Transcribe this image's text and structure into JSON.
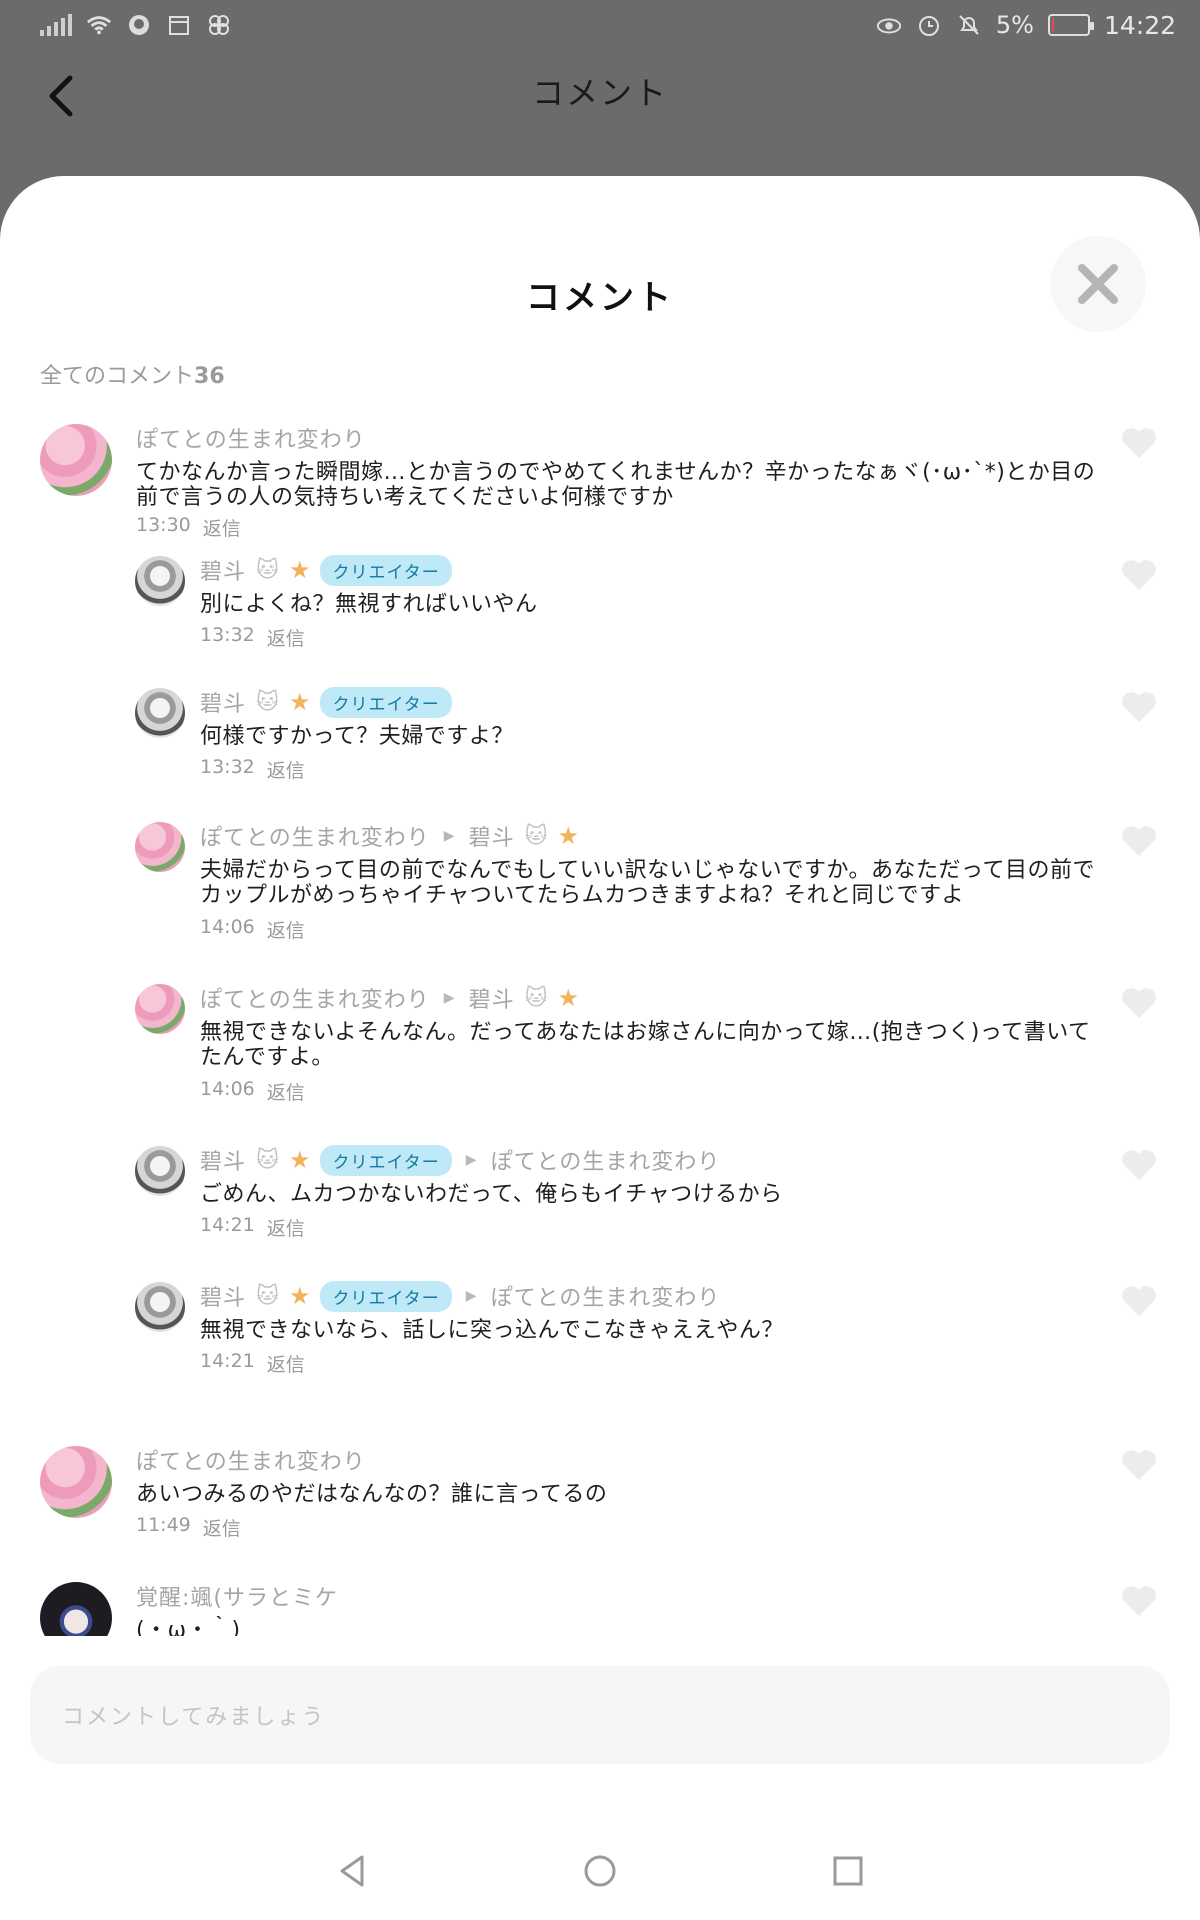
{
  "status_bar": {
    "battery_percent": "5%",
    "battery_level": 0.05,
    "time": "14:22",
    "battery_color": "#e64a4a"
  },
  "header": {
    "title": "コメント"
  },
  "sheet": {
    "title": "コメント",
    "count_label": "全てのコメント",
    "count_value": "36",
    "reply_label": "返信",
    "input_placeholder": "コメントしてみましょう"
  },
  "comments": [
    {
      "name": "ぽてとの生まれ変わり",
      "text": "てかなんか言った瞬間嫁…とか言うのでやめてくれませんか？辛かったなぁヾ(･ω･`*)とか目の前で言うの人の気持ちい考えてくださいよ何様ですか",
      "time": "13:30",
      "replies": [
        {
          "name": "碧斗",
          "badge": "クリエイター",
          "text": "別によくね？無視すればいいやん",
          "time": "13:32"
        },
        {
          "name": "碧斗",
          "badge": "クリエイター",
          "text": "何様ですかって？夫婦ですよ？",
          "time": "13:32"
        },
        {
          "name": "ぽてとの生まれ変わり",
          "to": "碧斗",
          "text": "夫婦だからって目の前でなんでもしていい訳ないじゃないですか。あなただって目の前でカップルがめっちゃイチャついてたらムカつきますよね？それと同じですよ",
          "time": "14:06"
        },
        {
          "name": "ぽてとの生まれ変わり",
          "to": "碧斗",
          "text": "無視できないよそんなん。だってあなたはお嫁さんに向かって嫁…(抱きつく)って書いてたんですよ。",
          "time": "14:06"
        },
        {
          "name": "碧斗",
          "badge": "クリエイター",
          "to": "ぽてとの生まれ変わり",
          "text": "ごめん、ムカつかないわだって、俺らもイチャつけるから",
          "time": "14:21"
        },
        {
          "name": "碧斗",
          "badge": "クリエイター",
          "to": "ぽてとの生まれ変わり",
          "text": "無視できないなら、話しに突っ込んでこなきゃええやん？",
          "time": "14:21"
        }
      ]
    },
    {
      "name": "ぽてとの生まれ変わり",
      "text": "あいつみるのやだはなんなの？誰に言ってるの",
      "time": "11:49"
    },
    {
      "name": "覚醒:颯(サラとミケ",
      "text": "(・ω・｀)"
    }
  ]
}
